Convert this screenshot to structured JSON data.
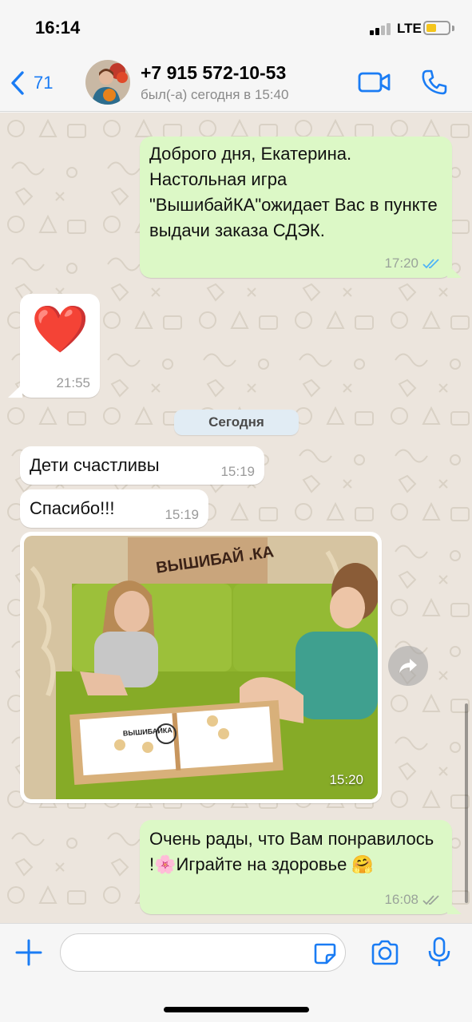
{
  "status_bar": {
    "time": "16:14",
    "network": "LTE",
    "battery_level": 0.45
  },
  "header": {
    "back_count": "71",
    "contact_name": "+7 915 572-10-53",
    "contact_status": "был(-а) сегодня в 15:40"
  },
  "messages": [
    {
      "direction": "out",
      "text": "Доброго дня, Екатерина. Настольная игра \"ВышибайКА\"ожидает Вас в пункте выдачи заказа СДЭК.",
      "time": "17:20",
      "read": true
    },
    {
      "direction": "in",
      "type": "emoji",
      "text": "❤️",
      "time": "21:55"
    },
    {
      "type": "date_separator",
      "text": "Сегодня"
    },
    {
      "direction": "in",
      "text": "Дети счастливы",
      "time": "15:19"
    },
    {
      "direction": "in",
      "text": "Спасибо!!!",
      "time": "15:19"
    },
    {
      "direction": "in",
      "type": "photo",
      "time": "15:20",
      "box_label": "ВЫШИБАЙ .КА",
      "board_label": "ВЫШИБАЙКА"
    },
    {
      "direction": "out",
      "text": "Очень рады, что Вам понравилось !🌸Играйте на здоровье 🤗",
      "time": "16:08",
      "read": false
    }
  ],
  "input": {
    "placeholder": ""
  },
  "colors": {
    "accent": "#1a7cf4",
    "outgoing_bubble": "#dcf8c6",
    "incoming_bubble": "#ffffff",
    "chat_background": "#ece5dd",
    "read_tick": "#4fb3f6"
  }
}
